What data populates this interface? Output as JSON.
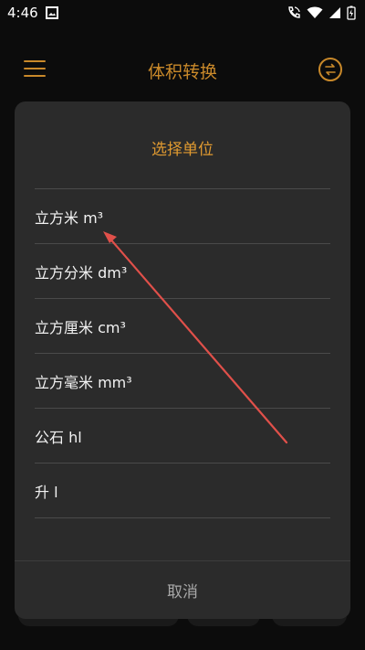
{
  "status_bar": {
    "time": "4:46"
  },
  "app_bar": {
    "title": "体积转换"
  },
  "dialog": {
    "title": "选择单位",
    "items": [
      {
        "label": "立方米  m³"
      },
      {
        "label": "立方分米 dm³"
      },
      {
        "label": "立方厘米 cm³"
      },
      {
        "label": "立方毫米 mm³"
      },
      {
        "label": "公石 hl"
      },
      {
        "label": "升 l"
      }
    ],
    "cancel_label": "取消"
  },
  "colors": {
    "accent": "#c9892a",
    "dialog_bg": "#2b2b2b",
    "annotation_arrow": "#e0504a"
  },
  "icons": [
    "menu-icon",
    "swap-icon",
    "image-icon",
    "wifi-call-icon",
    "wifi-icon",
    "signal-icon",
    "battery-icon"
  ]
}
